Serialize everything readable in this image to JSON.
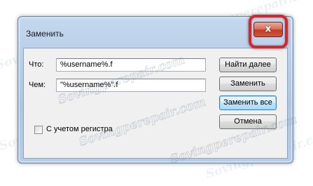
{
  "window": {
    "title": "Заменить",
    "close_glyph": "x"
  },
  "form": {
    "find_label": "Что:",
    "find_value": "%username%.f",
    "replace_label": "Чем:",
    "replace_value": "\"%username%\".f",
    "match_case_label": "С учетом регистра",
    "match_case_checked": false
  },
  "buttons": {
    "find_next": "Найти далее",
    "replace": "Заменить",
    "replace_all": "Заменить все",
    "cancel": "Отмена"
  },
  "watermark": {
    "text": "Sovingperepair.com"
  },
  "colors": {
    "highlight": "#d4262b",
    "close_button": "#c13c23"
  }
}
